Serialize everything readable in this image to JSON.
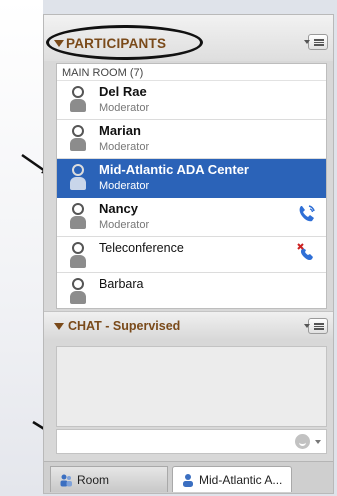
{
  "participants": {
    "title": "PARTICIPANTS",
    "room_label": "MAIN ROOM (7)",
    "rows": [
      {
        "name": "Del Rae",
        "role": "Moderator",
        "selected": false
      },
      {
        "name": "Marian",
        "role": "Moderator",
        "selected": false
      },
      {
        "name": "Mid-Atlantic ADA Center",
        "role": "Moderator",
        "selected": true
      },
      {
        "name": "Nancy",
        "role": "Moderator",
        "status_icon": "phone-connected-icon"
      },
      {
        "name": "Teleconference",
        "status_icon": "phone-muted-icon"
      },
      {
        "name": "Barbara"
      }
    ]
  },
  "chat": {
    "title": "CHAT - Supervised",
    "input_value": ""
  },
  "tabs": {
    "room": "Room",
    "active": "Mid-Atlantic A..."
  },
  "colors": {
    "header_text": "#7a4a1a",
    "selection": "#2b63b8",
    "status_blue": "#2f6fd6",
    "status_red": "#cc2222"
  }
}
